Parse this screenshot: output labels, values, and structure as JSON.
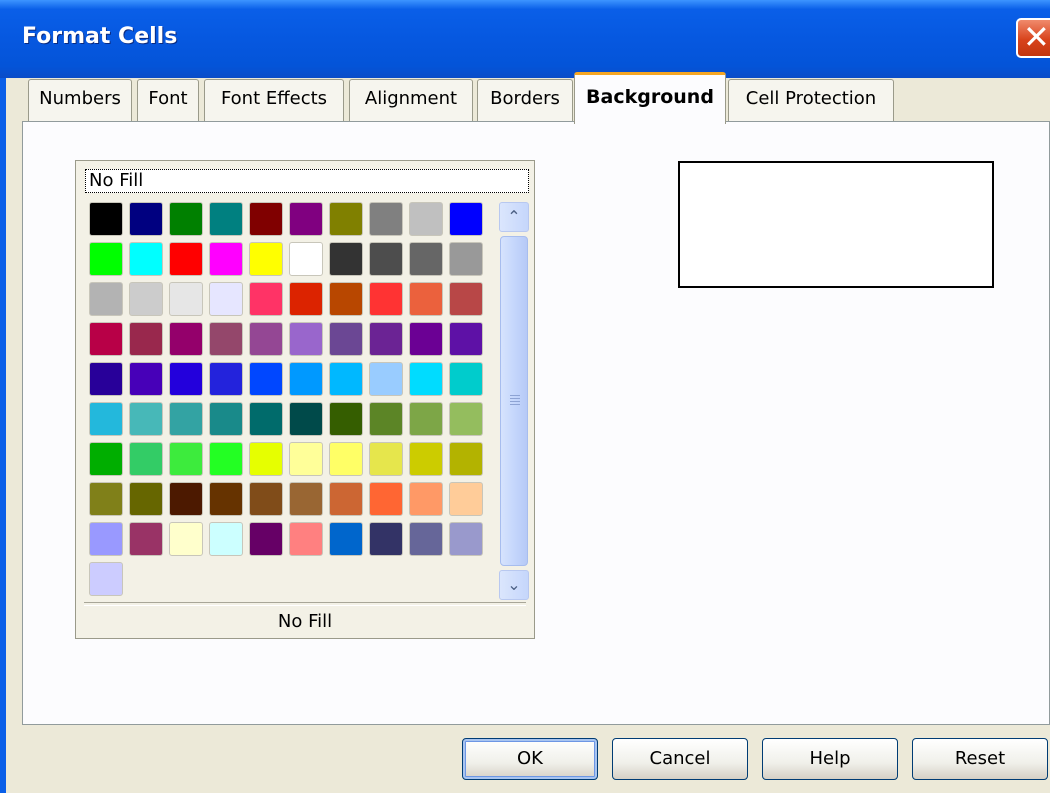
{
  "window": {
    "title": "Format Cells",
    "close_glyph": "✕"
  },
  "tabs": [
    {
      "label": "Numbers",
      "active": false
    },
    {
      "label": "Font",
      "active": false
    },
    {
      "label": "Font Effects",
      "active": false
    },
    {
      "label": "Alignment",
      "active": false
    },
    {
      "label": "Borders",
      "active": false
    },
    {
      "label": "Background",
      "active": true
    },
    {
      "label": "Cell Protection",
      "active": false
    }
  ],
  "palette": {
    "top_label": "No Fill",
    "bottom_label": "No Fill",
    "scroll_up_glyph": "⌃",
    "scroll_down_glyph": "⌄",
    "colors": [
      "#000000",
      "#000080",
      "#008000",
      "#008080",
      "#800000",
      "#800080",
      "#808000",
      "#808080",
      "#c0c0c0",
      "#0000ff",
      "#00ff00",
      "#00ffff",
      "#ff0000",
      "#ff00ff",
      "#ffff00",
      "#ffffff",
      "#333333",
      "#4d4d4d",
      "#666666",
      "#999999",
      "#b3b3b3",
      "#cccccc",
      "#e6e6e6",
      "#e6e6ff",
      "#ff3366",
      "#dc2300",
      "#b84700",
      "#ff3333",
      "#eb613d",
      "#b84747",
      "#b80047",
      "#99284d",
      "#94006b",
      "#94476b",
      "#944794",
      "#9966cc",
      "#6b4794",
      "#6b2394",
      "#6b0094",
      "#5e11a6",
      "#280099",
      "#4700b8",
      "#2300dc",
      "#2323dc",
      "#0047ff",
      "#0099ff",
      "#00b8ff",
      "#99ccff",
      "#00dcff",
      "#00cccc",
      "#23b8dc",
      "#47b8b8",
      "#33a3a3",
      "#198a8a",
      "#006b6b",
      "#004a4a",
      "#355e00",
      "#5c8526",
      "#7da647",
      "#94bd5e",
      "#00ae00",
      "#33cc66",
      "#3deb3d",
      "#23ff23",
      "#e6ff00",
      "#ffff99",
      "#ffff66",
      "#e6e64c",
      "#cccc00",
      "#b3b300",
      "#808019",
      "#666600",
      "#4c1900",
      "#663300",
      "#804c19",
      "#996633",
      "#cc6633",
      "#ff6633",
      "#ff9966",
      "#ffcc99",
      "#9999ff",
      "#993366",
      "#ffffcc",
      "#ccffff",
      "#660066",
      "#ff8080",
      "#0066cc",
      "#333366",
      "#666699",
      "#9999cc",
      "#ccccff"
    ]
  },
  "preview": {
    "color": "#ffffff"
  },
  "buttons": {
    "ok": "OK",
    "cancel": "Cancel",
    "help": "Help",
    "reset": "Reset"
  }
}
